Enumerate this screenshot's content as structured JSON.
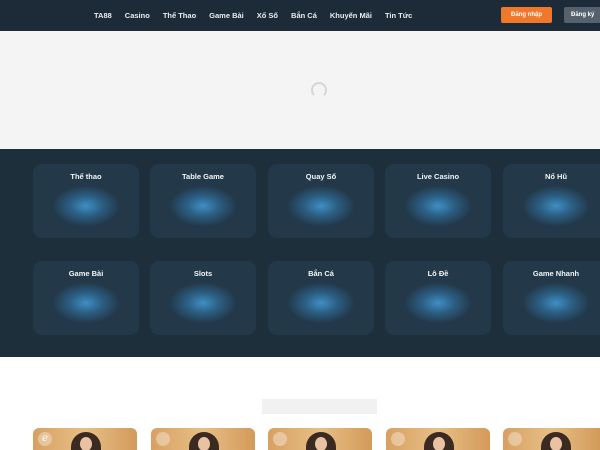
{
  "header": {
    "nav": [
      "TA88",
      "Casino",
      "Thể Thao",
      "Game Bài",
      "Xổ Số",
      "Bắn Cá",
      "Khuyến Mãi",
      "Tin Tức"
    ],
    "login_label": "Đăng nhập",
    "register_label": "Đăng ký"
  },
  "categories": {
    "row1": [
      "Thể thao",
      "Table Game",
      "Quay Số",
      "Live Casino",
      "Nổ Hũ"
    ],
    "row2": [
      "Game Bài",
      "Slots",
      "Bắn Cá",
      "Lô Đề",
      "Game Nhanh"
    ]
  },
  "colors": {
    "header_bg": "#1c2b37",
    "accent": "#f0782a",
    "section_bg": "#1d2f3b",
    "card_bg": "#23394a"
  },
  "icons": {
    "loading": "spinner-icon",
    "promo_logo": "e-logo-icon"
  }
}
